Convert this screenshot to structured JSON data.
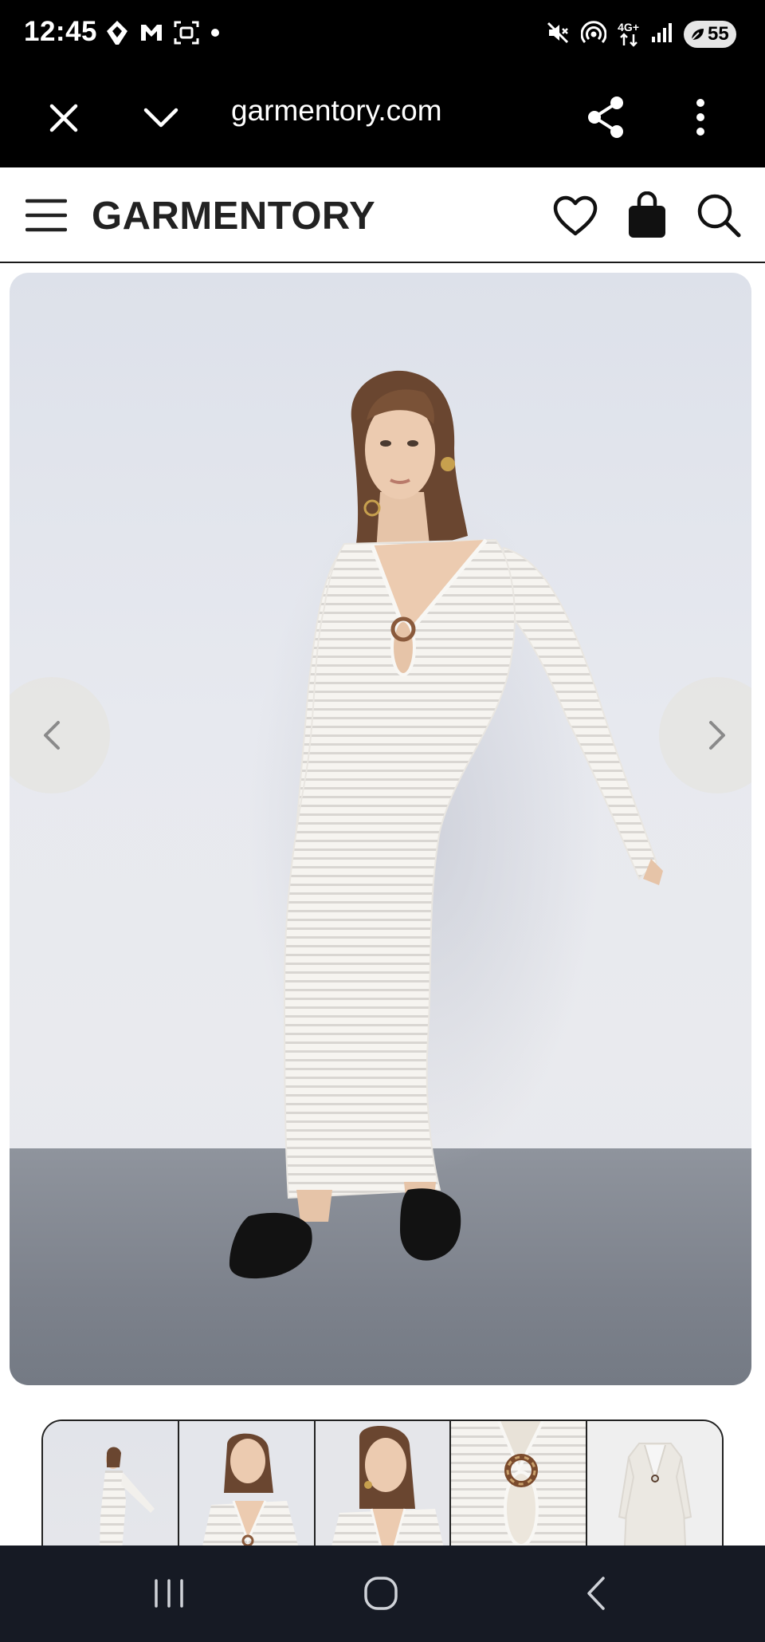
{
  "status_bar": {
    "time": "12:45",
    "network_label": "4G+",
    "battery_level": "55",
    "icons": [
      "diamond-icon",
      "gmail-icon",
      "screenshot-icon",
      "dot-icon",
      "mute-icon",
      "hotspot-icon",
      "network-4g-icon",
      "signal-icon",
      "battery-icon"
    ]
  },
  "browser": {
    "url": "garmentory.com",
    "icons": [
      "close-icon",
      "chevron-down-icon",
      "share-icon",
      "more-vert-icon"
    ]
  },
  "site_header": {
    "brand": "GARMENTORY",
    "icons": [
      "menu-icon",
      "heart-icon",
      "shopping-bag-icon",
      "search-icon"
    ]
  },
  "gallery": {
    "prev_icon": "chevron-left-icon",
    "next_icon": "chevron-right-icon",
    "thumbnails": [
      "thumbnail-full-body",
      "thumbnail-three-quarter",
      "thumbnail-closeup",
      "thumbnail-detail-ring",
      "thumbnail-flat-lay"
    ],
    "colors": {
      "wall": "#e3e5ec",
      "floor": "#7d828c",
      "dress": "#f4f2ee",
      "shoes": "#121212"
    }
  },
  "nav_bar": {
    "icons": [
      "recents-icon",
      "home-icon",
      "back-icon"
    ]
  }
}
